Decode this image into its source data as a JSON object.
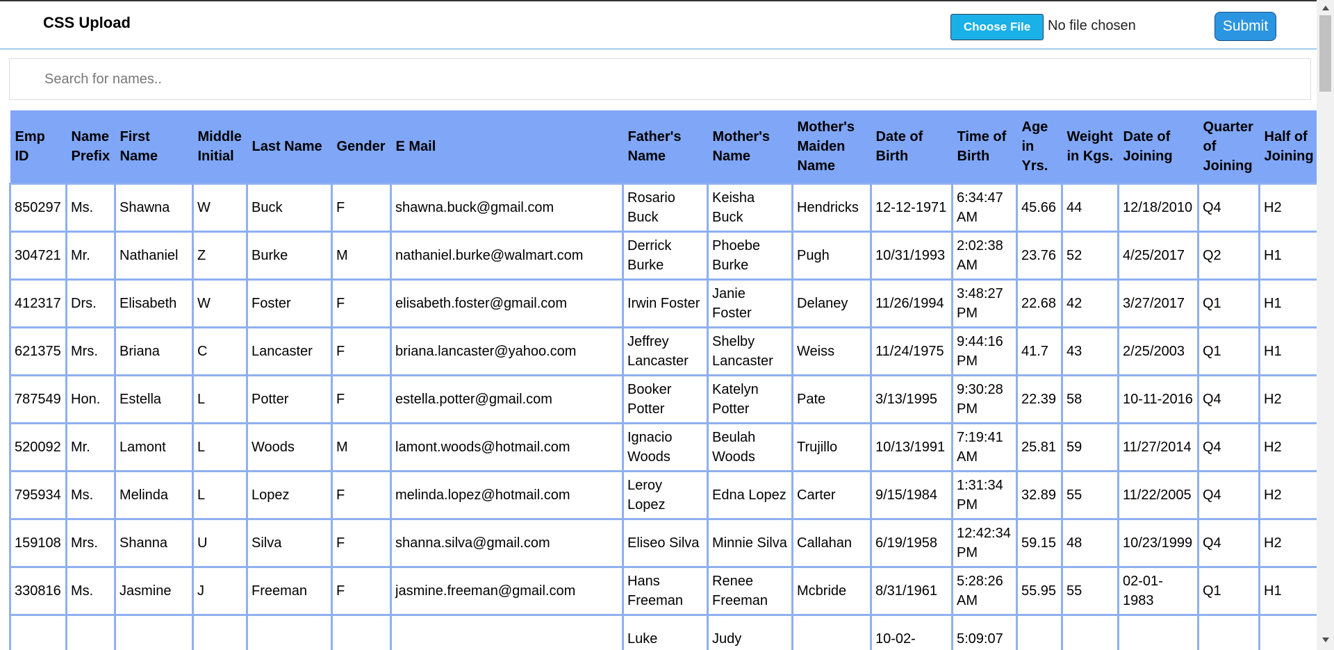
{
  "header": {
    "title": "CSS Upload",
    "choose_file_label": "Choose File",
    "file_status": "No file chosen",
    "submit_label": "Submit"
  },
  "search": {
    "placeholder": "Search for names.."
  },
  "table": {
    "columns": [
      "Emp ID",
      "Name Prefix",
      "First Name",
      "Middle Initial",
      "Last Name",
      "Gender",
      "E Mail",
      "Father's Name",
      "Mother's Name",
      "Mother's Maiden Name",
      "Date of Birth",
      "Time of Birth",
      "Age in Yrs.",
      "Weight in Kgs.",
      "Date of Joining",
      "Quarter of Joining",
      "Half of Joining"
    ],
    "rows": [
      [
        "850297",
        "Ms.",
        "Shawna",
        "W",
        "Buck",
        "F",
        "shawna.buck@gmail.com",
        "Rosario Buck",
        "Keisha Buck",
        "Hendricks",
        "12-12-1971",
        "6:34:47 AM",
        "45.66",
        "44",
        "12/18/2010",
        "Q4",
        "H2"
      ],
      [
        "304721",
        "Mr.",
        "Nathaniel",
        "Z",
        "Burke",
        "M",
        "nathaniel.burke@walmart.com",
        "Derrick Burke",
        "Phoebe Burke",
        "Pugh",
        "10/31/1993",
        "2:02:38 AM",
        "23.76",
        "52",
        "4/25/2017",
        "Q2",
        "H1"
      ],
      [
        "412317",
        "Drs.",
        "Elisabeth",
        "W",
        "Foster",
        "F",
        "elisabeth.foster@gmail.com",
        "Irwin Foster",
        "Janie Foster",
        "Delaney",
        "11/26/1994",
        "3:48:27 PM",
        "22.68",
        "42",
        "3/27/2017",
        "Q1",
        "H1"
      ],
      [
        "621375",
        "Mrs.",
        "Briana",
        "C",
        "Lancaster",
        "F",
        "briana.lancaster@yahoo.com",
        "Jeffrey Lancaster",
        "Shelby Lancaster",
        "Weiss",
        "11/24/1975",
        "9:44:16 PM",
        "41.7",
        "43",
        "2/25/2003",
        "Q1",
        "H1"
      ],
      [
        "787549",
        "Hon.",
        "Estella",
        "L",
        "Potter",
        "F",
        "estella.potter@gmail.com",
        "Booker Potter",
        "Katelyn Potter",
        "Pate",
        "3/13/1995",
        "9:30:28 PM",
        "22.39",
        "58",
        "10-11-2016",
        "Q4",
        "H2"
      ],
      [
        "520092",
        "Mr.",
        "Lamont",
        "L",
        "Woods",
        "M",
        "lamont.woods@hotmail.com",
        "Ignacio Woods",
        "Beulah Woods",
        "Trujillo",
        "10/13/1991",
        "7:19:41 AM",
        "25.81",
        "59",
        "11/27/2014",
        "Q4",
        "H2"
      ],
      [
        "795934",
        "Ms.",
        "Melinda",
        "L",
        "Lopez",
        "F",
        "melinda.lopez@hotmail.com",
        "Leroy Lopez",
        "Edna Lopez",
        "Carter",
        "9/15/1984",
        "1:31:34 PM",
        "32.89",
        "55",
        "11/22/2005",
        "Q4",
        "H2"
      ],
      [
        "159108",
        "Mrs.",
        "Shanna",
        "U",
        "Silva",
        "F",
        "shanna.silva@gmail.com",
        "Eliseo Silva",
        "Minnie Silva",
        "Callahan",
        "6/19/1958",
        "12:42:34 PM",
        "59.15",
        "48",
        "10/23/1999",
        "Q4",
        "H2"
      ],
      [
        "330816",
        "Ms.",
        "Jasmine",
        "J",
        "Freeman",
        "F",
        "jasmine.freeman@gmail.com",
        "Hans Freeman",
        "Renee Freeman",
        "Mcbride",
        "8/31/1961",
        "5:28:26 AM",
        "55.95",
        "55",
        "02-01-1983",
        "Q1",
        "H1"
      ],
      [
        "",
        "",
        "",
        "",
        "",
        "",
        "",
        "Luke",
        "Judy",
        "",
        "10-02-",
        "5:09:07",
        "",
        "",
        "",
        "",
        ""
      ]
    ]
  }
}
